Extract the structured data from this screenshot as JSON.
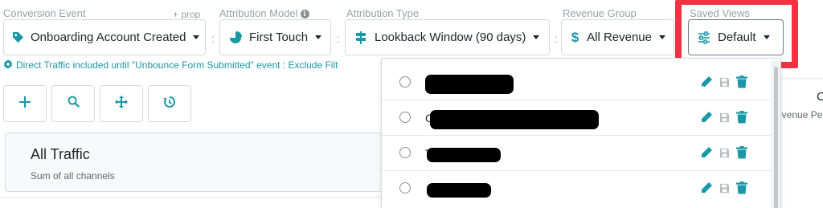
{
  "filters": {
    "conversion_event": {
      "label": "Conversion Event",
      "plus": "+ prop",
      "value": "Onboarding Account Created"
    },
    "attribution_model": {
      "label": "Attribution Model",
      "value": "First Touch"
    },
    "attribution_type": {
      "label": "Attribution Type",
      "value": "Lookback Window (90 days)"
    },
    "revenue_group": {
      "label": "Revenue Group",
      "value": "All Revenue"
    },
    "saved_views": {
      "label": "Saved Views",
      "value": "Default"
    }
  },
  "separator": ":",
  "note": "Direct Traffic included until \"Unbounce Form Submitted\" event : Exclude Filt",
  "toolbar": [
    "add-icon",
    "search-icon",
    "move-icon",
    "history-icon"
  ],
  "traffic": {
    "title": "All Traffic",
    "subtitle": "Sum of all channels"
  },
  "right_panel": {
    "header": "C",
    "subheader": "evenue Pe"
  },
  "saved_views_menu": {
    "items": [
      {
        "visible_text": "",
        "actions": [
          "edit-icon",
          "save-icon",
          "delete-icon"
        ]
      },
      {
        "visible_text": "C",
        "actions": [
          "edit-icon",
          "save-icon",
          "delete-icon"
        ]
      },
      {
        "visible_text": "T",
        "actions": [
          "edit-icon",
          "save-icon",
          "delete-icon"
        ]
      },
      {
        "visible_text": "",
        "actions": [
          "edit-icon",
          "save-icon",
          "delete-icon"
        ]
      }
    ]
  },
  "colors": {
    "accent": "#1b97a5",
    "highlight": "#ef3340",
    "text": "#1f2428",
    "muted": "#9aa0a6"
  }
}
